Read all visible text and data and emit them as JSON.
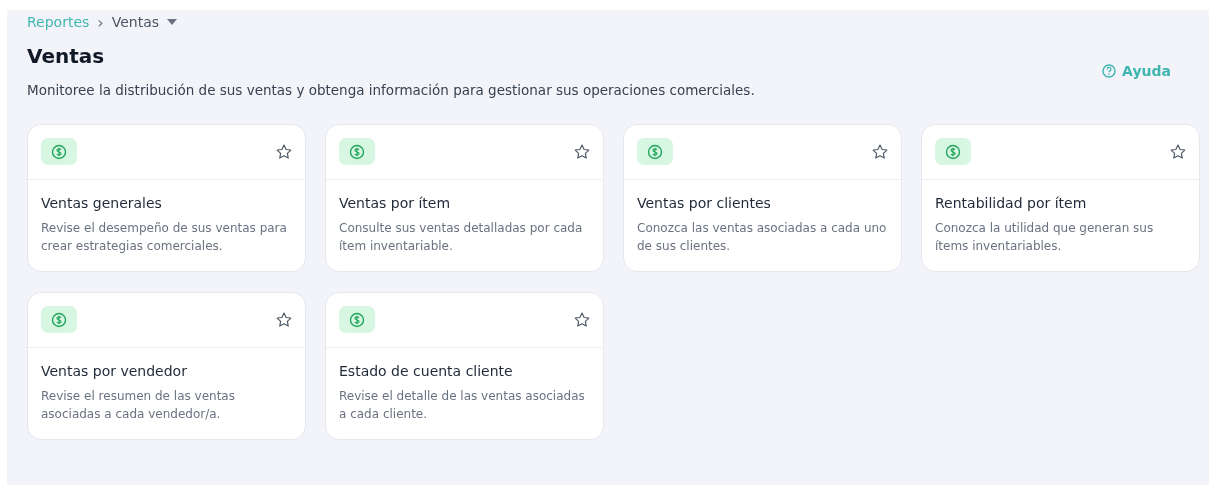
{
  "breadcrumb": {
    "parent": "Reportes",
    "separator": "›",
    "current": "Ventas"
  },
  "title": "Ventas",
  "description": "Monitoree la distribución de sus ventas y obtenga información para gestionar sus operaciones comerciales.",
  "help": {
    "label": "Ayuda"
  },
  "cards": [
    {
      "title": "Ventas generales",
      "description": "Revise el desempeño de sus ventas para crear estrategias comerciales.",
      "favorite": false
    },
    {
      "title": "Ventas por ítem",
      "description": "Consulte sus ventas detalladas por cada ítem inventariable.",
      "favorite": false
    },
    {
      "title": "Ventas por clientes",
      "description": "Conozca las ventas asociadas a cada uno de sus clientes.",
      "favorite": false
    },
    {
      "title": "Rentabilidad por ítem",
      "description": "Conozca la utilidad que generan sus ítems inventariables.",
      "favorite": false
    },
    {
      "title": "Ventas por vendedor",
      "description": "Revise el resumen de las ventas asociadas a cada vendedor/a.",
      "favorite": false
    },
    {
      "title": "Estado de cuenta cliente",
      "description": "Revise el detalle de las ventas asociadas a cada cliente.",
      "favorite": false
    }
  ]
}
